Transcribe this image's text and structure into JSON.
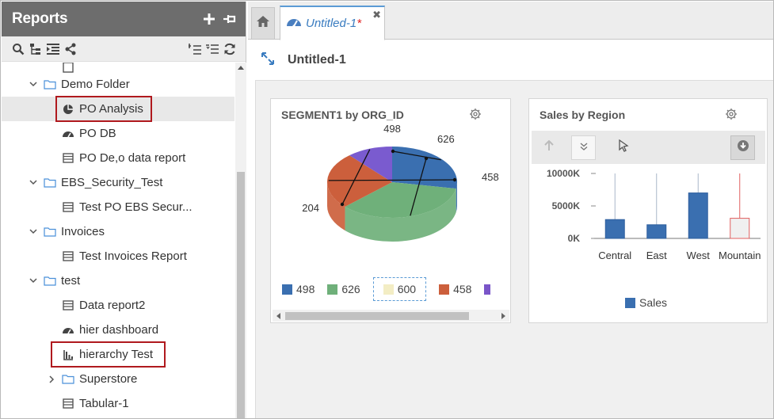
{
  "sidebar": {
    "title": "Reports",
    "tree": [
      {
        "label": "Demo Folder",
        "type": "folder",
        "expanded": true,
        "level": 1
      },
      {
        "label": "PO Analysis",
        "type": "pie-report",
        "level": 2,
        "selected": true,
        "highlighted": true
      },
      {
        "label": "PO DB",
        "type": "dashboard",
        "level": 2
      },
      {
        "label": "PO De,o data report",
        "type": "table-report",
        "level": 2
      },
      {
        "label": "EBS_Security_Test",
        "type": "folder",
        "expanded": true,
        "level": 1
      },
      {
        "label": "Test PO EBS Secur...",
        "type": "table-report",
        "level": 2
      },
      {
        "label": "Invoices",
        "type": "folder",
        "expanded": true,
        "level": 1
      },
      {
        "label": "Test Invoices Report",
        "type": "table-report",
        "level": 2
      },
      {
        "label": "test",
        "type": "folder",
        "expanded": true,
        "level": 1
      },
      {
        "label": "Data report2",
        "type": "table-report",
        "level": 2
      },
      {
        "label": "hier dashboard",
        "type": "dashboard",
        "level": 2
      },
      {
        "label": "hierarchy Test",
        "type": "bar-report",
        "level": 2,
        "highlighted": true
      },
      {
        "label": "Superstore",
        "type": "folder",
        "expanded": false,
        "level": 2
      },
      {
        "label": "Tabular-1",
        "type": "table-report",
        "level": 2
      }
    ]
  },
  "tabs": {
    "active_label": "Untitled-1",
    "unsaved_marker": "*"
  },
  "dashboard": {
    "title": "Untitled-1"
  },
  "widgets": {
    "pie": {
      "title": "SEGMENT1 by ORG_ID",
      "slice_labels": [
        "498",
        "626",
        "458",
        "204"
      ],
      "legend": [
        {
          "label": "498",
          "color": "#3a6fb0"
        },
        {
          "label": "626",
          "color": "#6fb07a"
        },
        {
          "label": "600",
          "color": "#f3edc4"
        },
        {
          "label": "458",
          "color": "#cc5f3c"
        }
      ]
    },
    "bar": {
      "title": "Sales by Region",
      "y_ticks": [
        "10000K",
        "5000K",
        "0K"
      ],
      "legend_label": "Sales",
      "legend_color": "#3a6fb0"
    }
  },
  "chart_data": [
    {
      "type": "pie",
      "title": "SEGMENT1 by ORG_ID",
      "labels": [
        "498",
        "626",
        "458",
        "204"
      ],
      "values": [
        498,
        626,
        458,
        204
      ],
      "colors": [
        "#3a6fb0",
        "#6fb07a",
        "#cc5f3c",
        "#7a55c8"
      ]
    },
    {
      "type": "bar",
      "title": "Sales by Region",
      "categories": [
        "Central",
        "East",
        "West",
        "Mountain"
      ],
      "series": [
        {
          "name": "Sales",
          "values": [
            2900,
            2100,
            7000,
            3100
          ]
        }
      ],
      "ylim": [
        0,
        10000
      ],
      "y_unit": "K",
      "colors": [
        "#3a6fb0",
        "#3a6fb0",
        "#3a6fb0",
        "#f0f0f0"
      ],
      "grid": false,
      "legend": "bottom"
    }
  ]
}
